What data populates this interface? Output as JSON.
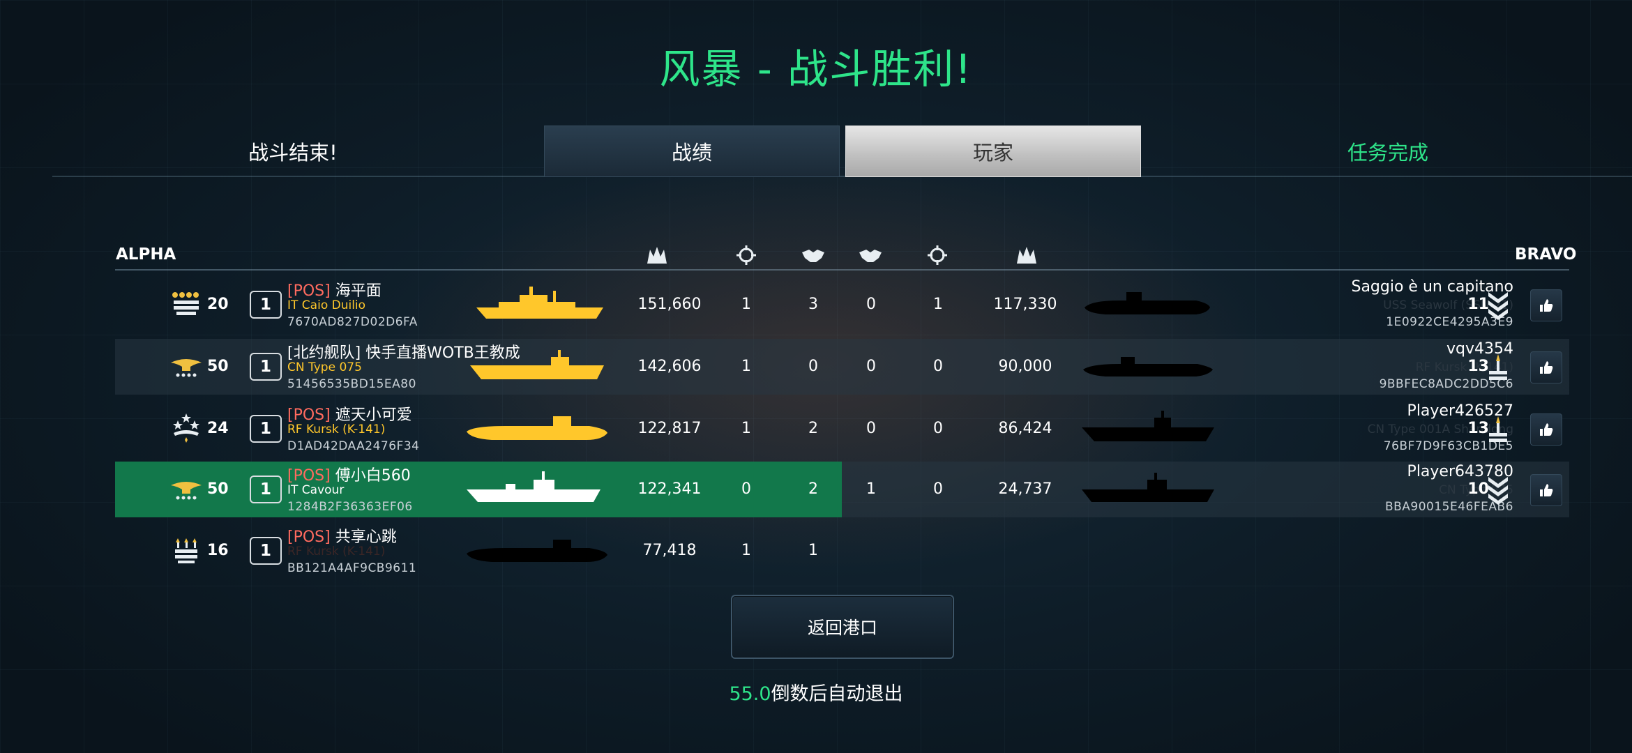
{
  "title": "风暴 - 战斗胜利!",
  "tabs": {
    "left": "战斗结束!",
    "stats": "战绩",
    "players": "玩家",
    "right": "任务完成"
  },
  "teams": {
    "alpha": "ALPHA",
    "bravo": "BRAVO"
  },
  "colors": {
    "accent_green": "#2ee58a",
    "highlight_row": "#12784b",
    "tag_red": "#ff6b5f",
    "ship_yellow": "#ffc72b"
  },
  "column_icons": [
    "damage-icon",
    "crosshair-icon",
    "assist-icon",
    "assist-icon",
    "crosshair-icon",
    "damage-icon"
  ],
  "rows": [
    {
      "left": {
        "level": "20",
        "squad": "1",
        "tag": "[POS]",
        "name": "海平面",
        "ship": "IT Caio Duilio",
        "id": "7670AD827D02D6FA"
      },
      "damage": "151,660",
      "kills": "1",
      "assists": "3",
      "r_assists": "0",
      "r_kills": "1",
      "r_damage": "117,330",
      "right": {
        "name": "Saggio è un capitano",
        "ship": "USS Seawolf (SSN-21)",
        "id": "1E0922CE4295A3E9",
        "level": "11"
      }
    },
    {
      "left": {
        "level": "50",
        "squad": "1",
        "tag": "",
        "name": "[北约舰队] 快手直播WOTB王教成",
        "ship": "CN Type 075",
        "id": "51456535BD15EA80"
      },
      "damage": "142,606",
      "kills": "1",
      "assists": "0",
      "r_assists": "0",
      "r_kills": "0",
      "r_damage": "90,000",
      "right": {
        "name": "vqv4354",
        "ship": "RF Kursk (K-141)",
        "id": "9BBFEC8ADC2DD5C6",
        "level": "13"
      }
    },
    {
      "left": {
        "level": "24",
        "squad": "1",
        "tag": "[POS]",
        "name": "遮天小可爱",
        "ship": "RF Kursk (K-141)",
        "id": "D1AD42DAA2476F34"
      },
      "damage": "122,817",
      "kills": "1",
      "assists": "2",
      "r_assists": "0",
      "r_kills": "0",
      "r_damage": "86,424",
      "right": {
        "name": "Player426527",
        "ship": "CN Type 001A Shandong",
        "id": "76BF7D9F63CB1DE5",
        "level": "13"
      }
    },
    {
      "left": {
        "level": "50",
        "squad": "1",
        "tag": "[POS]",
        "name": "傅小白560",
        "ship": "IT Cavour",
        "id": "1284B2F36363EF06"
      },
      "damage": "122,341",
      "kills": "0",
      "assists": "2",
      "r_assists": "1",
      "r_kills": "0",
      "r_damage": "24,737",
      "right": {
        "name": "Player643780",
        "ship": "CN Type 075",
        "id": "BBA90015E46FEAB6",
        "level": "10"
      }
    },
    {
      "left": {
        "level": "16",
        "squad": "1",
        "tag": "[POS]",
        "name": "共享心跳",
        "ship": "RF Kursk (K-141)",
        "id": "BB121A4AF9CB9611"
      },
      "damage": "77,418",
      "kills": "1",
      "assists": "1"
    }
  ],
  "return_button": "返回港口",
  "countdown": {
    "value": "55.0",
    "text": "倒数后自动退出"
  }
}
